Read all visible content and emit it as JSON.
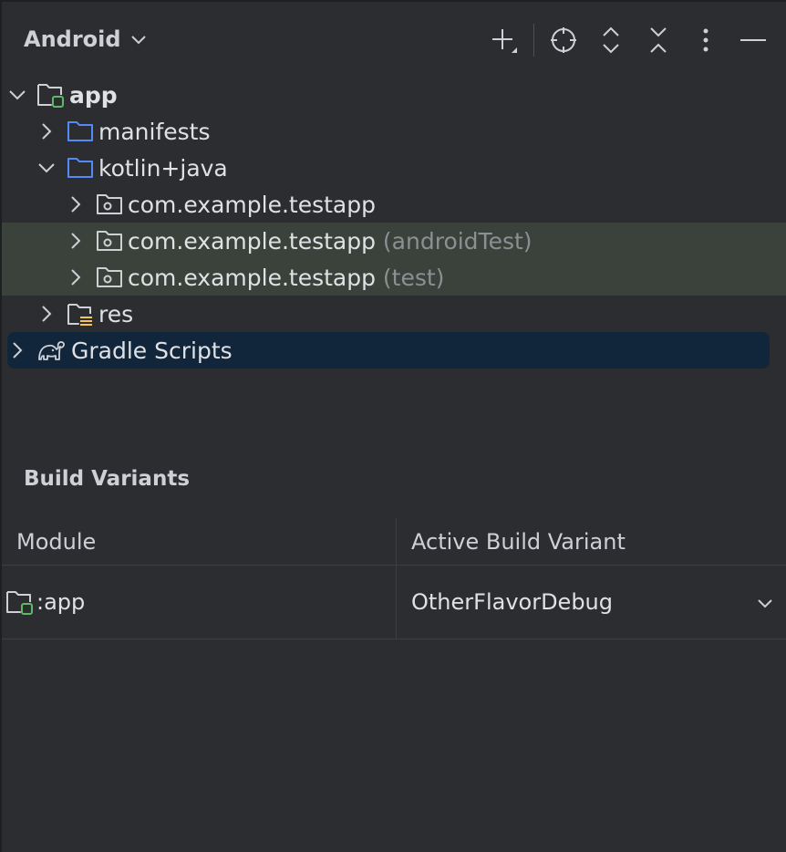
{
  "header": {
    "view_selector_label": "Android",
    "toolbar": [
      "add-icon",
      "locate-icon",
      "expand-all-icon",
      "collapse-all-icon",
      "more-options-icon",
      "hide-icon"
    ]
  },
  "tree": {
    "app": "app",
    "manifests": "manifests",
    "kotlin_java": "kotlin+java",
    "pkg_main": "com.example.testapp",
    "pkg_android_test": "com.example.testapp",
    "pkg_android_test_suffix": "(androidTest)",
    "pkg_test": "com.example.testapp",
    "pkg_test_suffix": "(test)",
    "res": "res",
    "gradle_scripts": "Gradle Scripts"
  },
  "build_variants": {
    "title": "Build Variants",
    "columns": [
      "Module",
      "Active Build Variant"
    ],
    "rows": [
      {
        "module": ":app",
        "variant": "OtherFlavorDebug"
      }
    ]
  },
  "colors": {
    "background": "#2b2d30",
    "text": "#dfe1e5",
    "secondary_text": "#8c8f94",
    "folder_blue": "#548af7",
    "module_green": "#5fb865",
    "test_highlight": "#3b423b",
    "selection": "#12263b",
    "res_yellow": "#f2c55c"
  }
}
